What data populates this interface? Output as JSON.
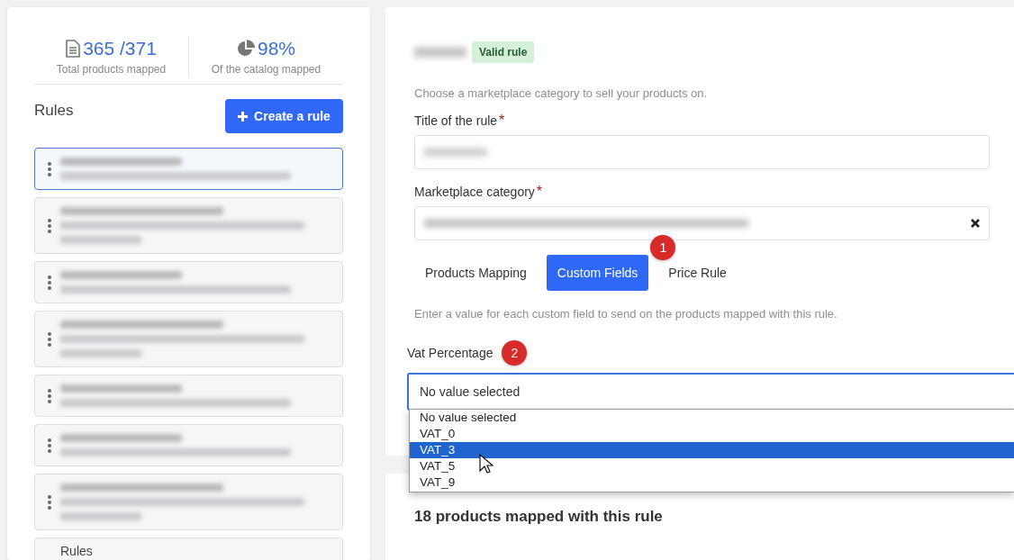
{
  "stats": [
    {
      "kind": "document",
      "value": "365 /371",
      "caption": "Total products mapped"
    },
    {
      "kind": "pie",
      "value": "98%",
      "caption": "Of the catalog mapped"
    }
  ],
  "rules_panel": {
    "heading": "Rules",
    "create_button": "Create a rule",
    "rules": [
      {
        "selected": true,
        "kind": "two-line"
      },
      {
        "selected": false,
        "kind": "three-line"
      },
      {
        "selected": false,
        "kind": "two-line"
      },
      {
        "selected": false,
        "kind": "three-line"
      },
      {
        "selected": false,
        "kind": "two-line"
      },
      {
        "selected": false,
        "kind": "two-line"
      },
      {
        "selected": false,
        "kind": "three-line"
      },
      {
        "selected": false,
        "kind": "titled",
        "title": "Rules"
      }
    ]
  },
  "rule_editor": {
    "status_badge": "Valid rule",
    "intro": "Choose a marketplace category to sell your products on.",
    "fields": [
      {
        "label": "Title of the rule",
        "required_mark": "*",
        "clearable": false
      },
      {
        "label": "Marketplace category",
        "required_mark": "*",
        "clearable": true
      }
    ],
    "tabs": [
      {
        "label": "Products Mapping",
        "selected": false
      },
      {
        "label": "Custom Fields",
        "selected": true,
        "marker": "1"
      },
      {
        "label": "Price Rule",
        "selected": false
      }
    ],
    "tab_hint": "Enter a value for each custom field to send on the products mapped with this rule.",
    "custom_field": {
      "label": "Vat Percentage",
      "marker": "2",
      "value": "No value selected",
      "expanded": true,
      "options": [
        {
          "label": "No value selected",
          "highlighted": false
        },
        {
          "label": "VAT_0",
          "highlighted": false
        },
        {
          "label": "VAT_3",
          "highlighted": true
        },
        {
          "label": "VAT_5",
          "highlighted": false
        },
        {
          "label": "VAT_9",
          "highlighted": false
        }
      ]
    }
  },
  "mapped_summary": "18 products mapped with this rule"
}
